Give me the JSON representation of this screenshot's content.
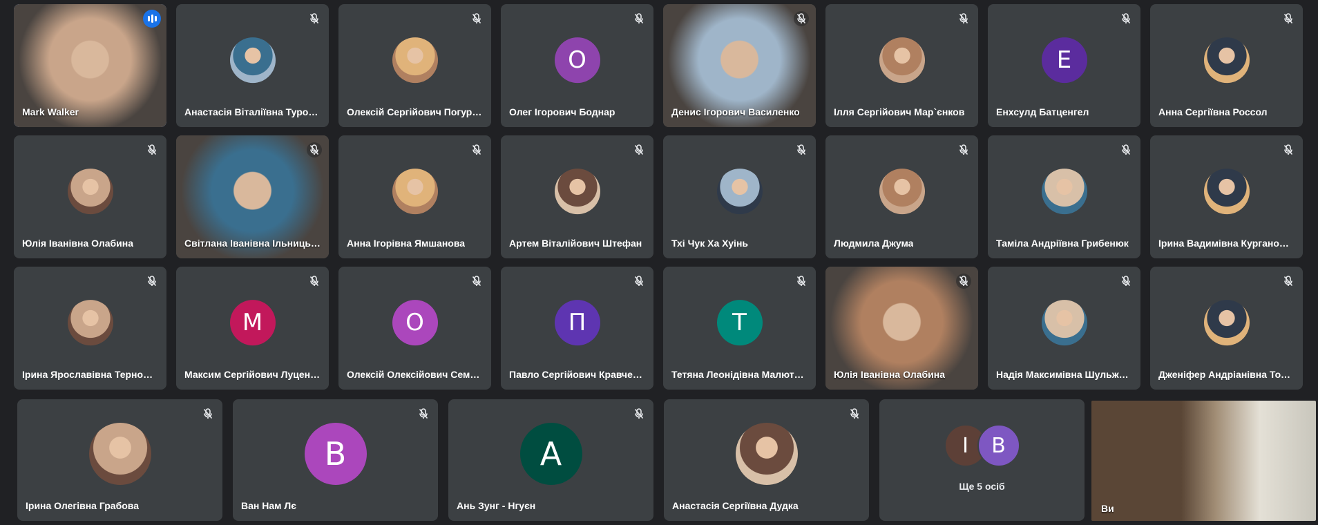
{
  "participants": [
    {
      "name": "Mark Walker",
      "type": "video",
      "speaking": true
    },
    {
      "name": "Анастасія Віталіївна Туров…",
      "type": "photo"
    },
    {
      "name": "Олексій Сергійович Погур…",
      "type": "photo"
    },
    {
      "name": "Олег Ігорович Боднар",
      "type": "letter",
      "letter": "О",
      "color": "#8e44ad"
    },
    {
      "name": "Денис Ігорович Василенко",
      "type": "video"
    },
    {
      "name": "Ілля Сергійович Мар`єнков",
      "type": "photo"
    },
    {
      "name": "Енхсулд Батценгел",
      "type": "letter",
      "letter": "Е",
      "color": "#5b2c9e"
    },
    {
      "name": "Анна Сергіївна Россол",
      "type": "photo"
    },
    {
      "name": "Юлія Іванівна Олабина",
      "type": "photo"
    },
    {
      "name": "Світлана Іванівна Ільниць…",
      "type": "video"
    },
    {
      "name": "Анна Ігорівна Ямшанова",
      "type": "photo"
    },
    {
      "name": "Артем Віталійович Штефан",
      "type": "photo"
    },
    {
      "name": "Тхі Чук Ха Хуінь",
      "type": "photo"
    },
    {
      "name": "Людмила Джума",
      "type": "photo"
    },
    {
      "name": "Таміла Андріївна Грибенюк",
      "type": "photo"
    },
    {
      "name": "Ірина Вадимівна Курганов…",
      "type": "photo"
    },
    {
      "name": "Ірина Ярославівна Тернове…",
      "type": "photo"
    },
    {
      "name": "Максим Сергійович Луценко",
      "type": "letter",
      "letter": "М",
      "color": "#c2185b"
    },
    {
      "name": "Олексій Олексійович Семе…",
      "type": "letter",
      "letter": "О",
      "color": "#ab47bc"
    },
    {
      "name": "Павло Сергійович Кравчен…",
      "type": "letter",
      "letter": "П",
      "color": "#5e35b1"
    },
    {
      "name": "Тетяна Леонідівна Малюте…",
      "type": "letter",
      "letter": "Т",
      "color": "#00897b"
    },
    {
      "name": "Юлія Іванівна Олабина",
      "type": "video"
    },
    {
      "name": "Надія Максимівна Шульжи…",
      "type": "photo"
    },
    {
      "name": "Дженіфер Андріанівна Тод…",
      "type": "photo"
    },
    {
      "name": "Ірина Олегівна Грабова",
      "type": "photo"
    },
    {
      "name": "Ван Нам Лє",
      "type": "letter",
      "letter": "В",
      "color": "#ab47bc"
    },
    {
      "name": "Ань Зунг - Нгуєн",
      "type": "letter",
      "letter": "A",
      "color": "#004d40"
    },
    {
      "name": "Анастасія Сергіївна Дудка",
      "type": "photo"
    }
  ],
  "more": {
    "label": "Ще 5 осіб",
    "avatars": [
      {
        "letter": "І",
        "color": "#5d4037"
      },
      {
        "letter": "В",
        "color": "#7e57c2"
      }
    ]
  },
  "self": {
    "name": "Ви"
  },
  "icons": {
    "mic_muted": "mic-off-icon",
    "speaking": "audio-level-icon"
  }
}
